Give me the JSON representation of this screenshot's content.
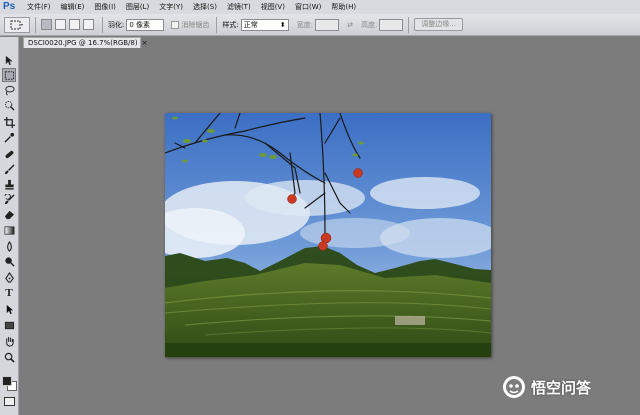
{
  "app": {
    "logo": "Ps"
  },
  "menu": [
    "文件(F)",
    "编辑(E)",
    "图像(I)",
    "图层(L)",
    "文字(Y)",
    "选择(S)",
    "滤镜(T)",
    "视图(V)",
    "窗口(W)",
    "帮助(H)"
  ],
  "options": {
    "feather_label": "羽化:",
    "feather_value": "0 像素",
    "antialias_label": "消除锯齿",
    "style_label": "样式:",
    "style_value": "正常",
    "width_label": "宽度:",
    "height_label": "高度:",
    "refine_edge_label": "调整边缘..."
  },
  "document": {
    "tab_title": "DSCI0020.JPG @ 16.7%(RGB/8)",
    "close_glyph": "×"
  },
  "tools": [
    "move-tool",
    "marquee-tool",
    "lasso-tool",
    "quick-selection-tool",
    "crop-tool",
    "eyedropper-tool",
    "healing-brush-tool",
    "brush-tool",
    "clone-stamp-tool",
    "history-brush-tool",
    "eraser-tool",
    "gradient-tool",
    "blur-tool",
    "dodge-tool",
    "pen-tool",
    "type-tool",
    "path-selection-tool",
    "rectangle-tool",
    "hand-tool",
    "zoom-tool"
  ],
  "colors": {
    "foreground": "#222222",
    "background": "#ffffff",
    "accent": "#1d5fb3"
  },
  "watermark": {
    "text": "悟空问答"
  }
}
